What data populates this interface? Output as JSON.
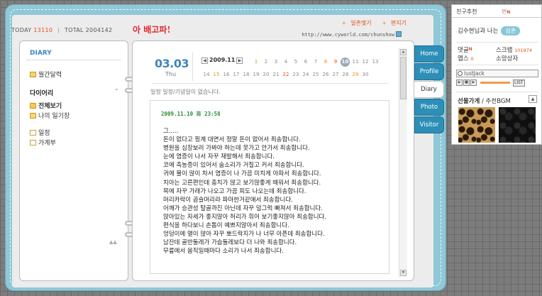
{
  "header": {
    "today_label": "TODAY",
    "today_count": "13110",
    "total_label": "TOTAL",
    "total_count": "2004142",
    "home_title": "아 배고파!",
    "link_ilchon": "일촌맺기",
    "link_pyeonji": "편지기",
    "url": "http://www.cyworld.com/chunshow"
  },
  "sidebar": {
    "heading": "DIARY",
    "monthly": "월간달력",
    "section_title": "다이어리",
    "items": [
      {
        "label": "전체보기"
      },
      {
        "label": "나의 일기장"
      },
      {
        "label": "일정"
      },
      {
        "label": "가계부"
      }
    ]
  },
  "calendar": {
    "date_big": "03.03",
    "day": "Thu",
    "month": "2009.11",
    "days_row1": [
      "1",
      "2",
      "3",
      "4",
      "5",
      "6",
      "7",
      "8",
      "9",
      "10",
      "11",
      "12",
      "13"
    ],
    "days_row2": [
      "14",
      "15",
      "16",
      "17",
      "18",
      "19",
      "20",
      "21",
      "22",
      "23",
      "24",
      "25",
      "26",
      "27",
      "28",
      "29",
      "30"
    ],
    "selected_day": "10"
  },
  "main": {
    "no_memo": "일정 일정/기념일이 없습니다.",
    "post_date": "2009.11.10 화 23:58",
    "post_lines": [
      "그.....",
      "돈이 없다고 핑계 대면서 정말 돈이 없어서 죄송합니다.",
      "병원을 심장보러 가봐야 하는데 못가고 안가서 죄송합니다.",
      "눈에 염증이 나서 자꾸 재발해서 죄송합니다.",
      "코에 축농증이 있어서 숨소리가 거질고 커서 죄송합니다.",
      "귀에 물이 많이 차서 염증이 나 가끔 미치게 아파서 죄송합니다.",
      "치아는 고른편인데 충치가 많고 보기않좋게 떼워서 죄송합니다.",
      "목에 자꾸 가래가 나오고 가끔 피도 나오는데 죄송합니다.",
      "머리카락이 곱슬머리라 파마한거같애서 죄송합니다.",
      "어깨가 승관성 탈골까진 아닌데 자꾸 덜그럭 빠져서 죄송합니다.",
      "앉아있는 자세가 좋지않아 허리가 휘어 보기좋지않아 죄송합니다.",
      "편식을 하다보니 손톱이 예쁘지않아서 죄송합니다.",
      "엉덩이에 열이 많아 자꾸 뽀드락지가 나 너무 아픈데 죄송합니다.",
      "남잔데 골반둘레가 가슴둘레보다 더 나와 죄송합니다.",
      "무릎에서 움직일때마다 소리가 나서 죄송합니다."
    ]
  },
  "tabs": [
    {
      "label": "Home"
    },
    {
      "label": "Profile"
    },
    {
      "label": "Diary"
    },
    {
      "label": "Photo"
    },
    {
      "label": "Visitor"
    }
  ],
  "panel": {
    "tab_friends": "친구추천",
    "tab_second": "편",
    "friend_text": "김수현님과 나는",
    "friend_badge": "삼촌",
    "stat_comment": "댓글",
    "stat_scrap": "스크랩",
    "stat_scrap_count": "101974",
    "stat_app": "앱스",
    "stat_app_count": "0",
    "stat_sound": "소망상자",
    "track": "lustJack",
    "list_label": "LIST",
    "bgm_title": "선물가게",
    "bgm_sub": "/ 추천BGM"
  },
  "colors": {
    "frame": "#8fc9d8",
    "tab_blue": "#2d8fb8",
    "accent_orange": "#e0541c",
    "date_blue": "#3f86b8",
    "post_green": "#2d8c37"
  }
}
